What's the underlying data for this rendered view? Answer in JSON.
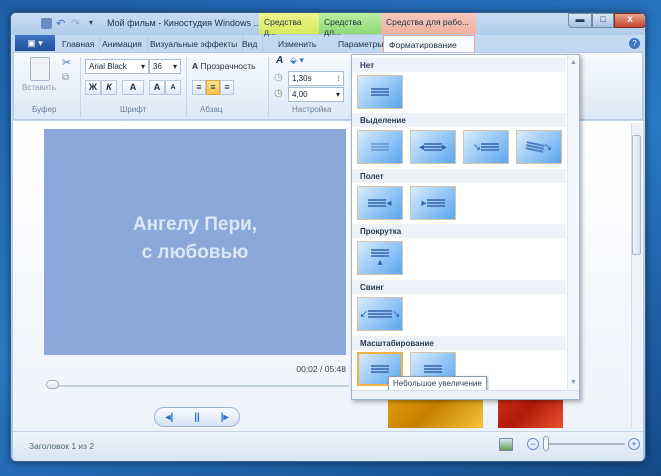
{
  "title": "Мой фильм - Киностудия Windows ...",
  "context_tabs": [
    "Средства д...",
    "Средства дл...",
    "Средства для рабо..."
  ],
  "tabs": [
    "Главная",
    "Анимация",
    "Визуальные эффекты",
    "Вид",
    "Изменить",
    "Параметры",
    "Форматирование"
  ],
  "ribbon": {
    "paste": "Вставить",
    "clipboard": "Буфер",
    "font_name": "Arial Black",
    "font_size": "36",
    "bold": "Ж",
    "italic": "К",
    "font_color": "A",
    "grow": "A",
    "shrink": "A",
    "font_group": "Шрифт",
    "transparency": "Прозрачность",
    "paragraph": "Абзац",
    "start_time": "1,30s",
    "duration": "4,00",
    "settings": "Настройка"
  },
  "preview": {
    "line1": "Ангелу Пери,",
    "line2": "с любовью",
    "time": "00:02 / 05:48",
    "bg_color": "#8aa9d9"
  },
  "effects": {
    "sections": [
      "Нет",
      "Выделение",
      "Полет",
      "Прокрутка",
      "Свинг",
      "Масштабирование"
    ],
    "tooltip": "Небольшое увеличение"
  },
  "status": {
    "text": "Заголовок 1 из 2"
  }
}
